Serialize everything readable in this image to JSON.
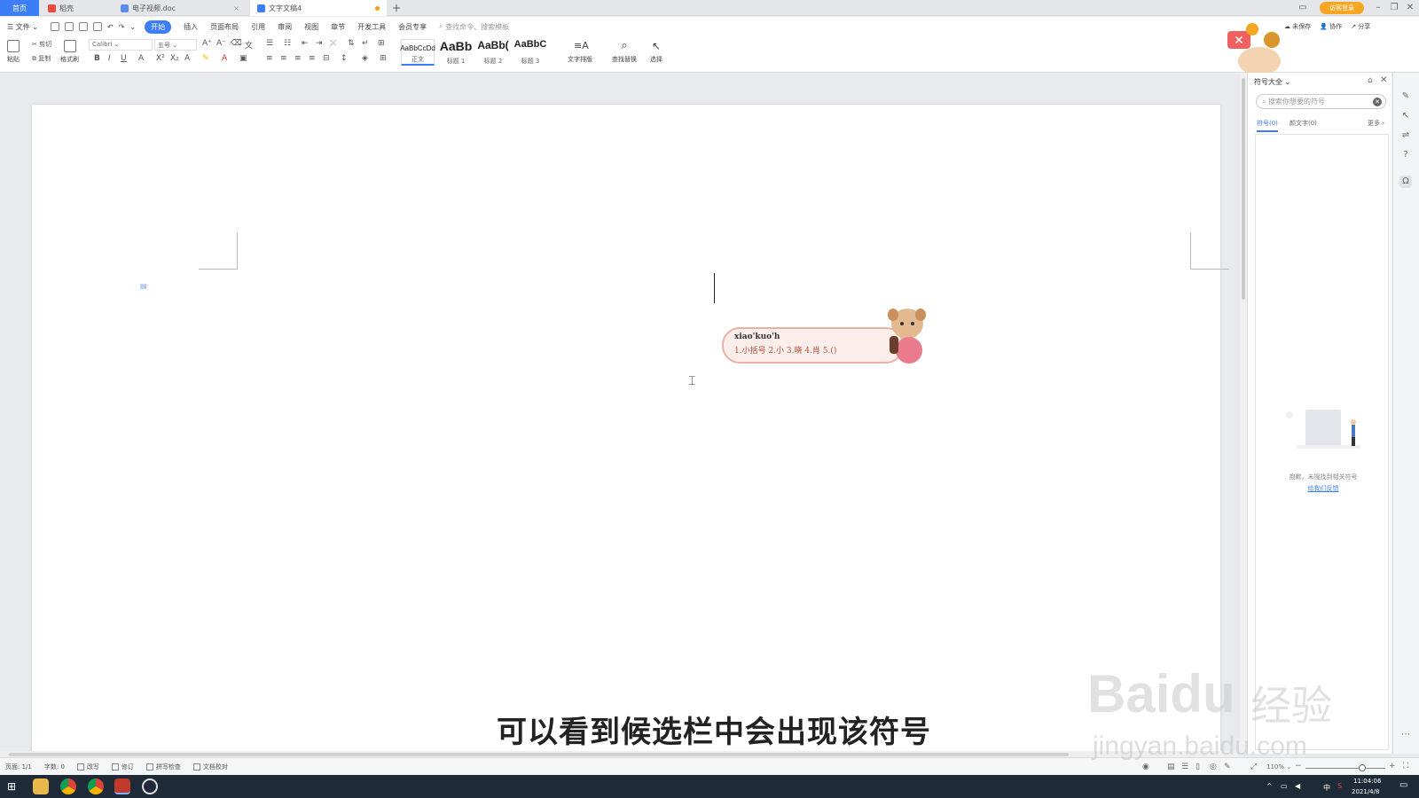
{
  "tabs": {
    "home": "首页",
    "daoke": "稻壳",
    "doc1": "电子视频.doc",
    "doc2": "文字文稿4",
    "new": "+"
  },
  "visitor_login": "访客登录",
  "menu": {
    "file": "文件",
    "items": [
      "开始",
      "插入",
      "页面布局",
      "引用",
      "审阅",
      "视图",
      "章节",
      "开发工具",
      "会员专享"
    ],
    "search_placeholder": "查找命令、搜索模板"
  },
  "ribbon": {
    "paste": "粘贴",
    "cut": "剪切",
    "copy": "复制",
    "format_painter": "格式刷",
    "font_name": "Calibri",
    "font_size": "五号",
    "styles": [
      {
        "sample": "AaBbCcDd",
        "name": "正文"
      },
      {
        "sample": "AaBb",
        "name": "标题 1"
      },
      {
        "sample": "AaBb(",
        "name": "标题 2"
      },
      {
        "sample": "AaBbC",
        "name": "标题 3"
      }
    ],
    "text_layout": "文字排版",
    "find_replace": "查找替换",
    "select": "选择"
  },
  "top_actions": {
    "unsaved": "未保存",
    "collab": "协作",
    "share": "分享"
  },
  "ime": {
    "pinyin": "xiao'kuo'h",
    "candidates": "1.小括号  2.小  3.晓  4.肖  5.()"
  },
  "panel": {
    "title": "符号大全",
    "search_placeholder": "搜索你想要的符号",
    "tab_symbol": "符号(0)",
    "tab_emoji": "颜文字(0)",
    "more": "更多",
    "empty_text": "抱歉，未搜找到相关符号",
    "feedback": "给我们反馈"
  },
  "status": {
    "page": "页面: 1/1",
    "words": "字数: 0",
    "rewrite": "改写",
    "revise": "修订",
    "spellcheck": "拼写检查",
    "proofread": "文档校对",
    "zoom": "110%"
  },
  "taskbar": {
    "ime": "中",
    "time": "11:04:06",
    "date": "2021/4/8"
  },
  "subtitle": "可以看到候选栏中会出现该符号",
  "watermark": {
    "brand": "Baidu",
    "cn": "经验",
    "url": "jingyan.baidu.com"
  }
}
